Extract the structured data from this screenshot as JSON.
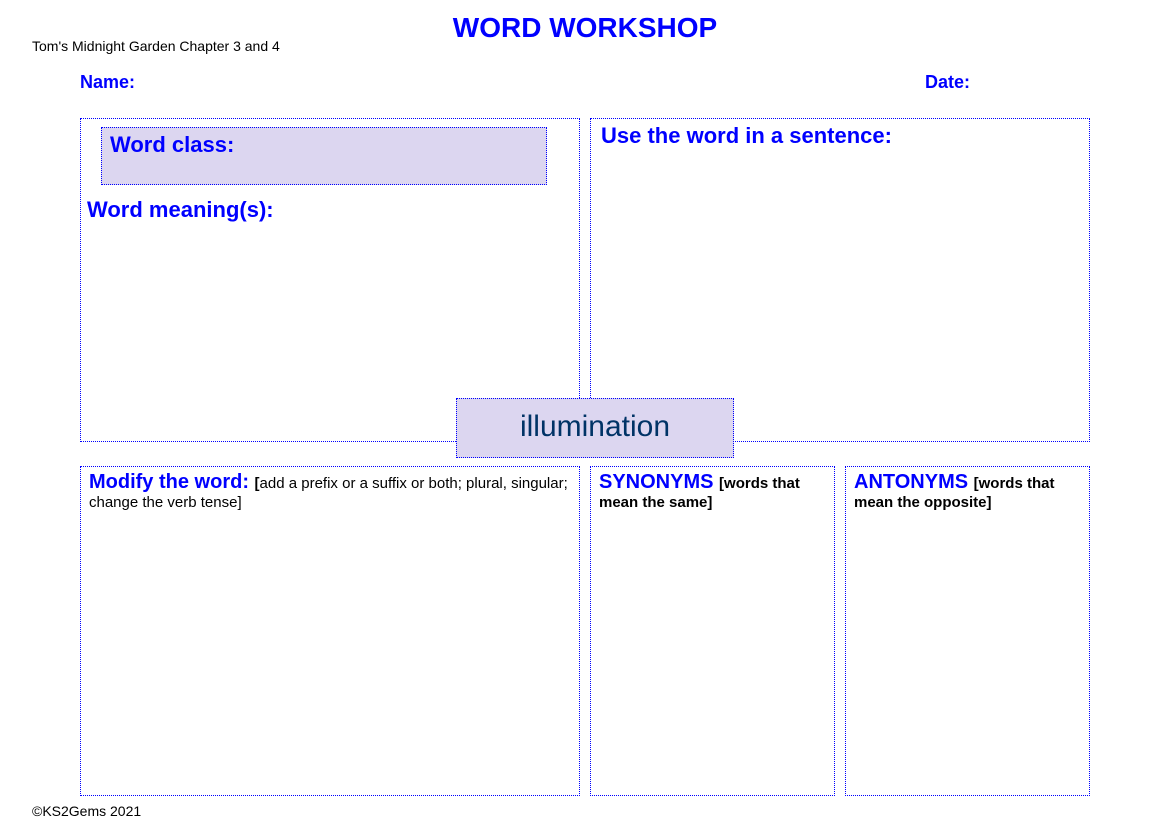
{
  "title": "WORD WORKSHOP",
  "subtitle": "Tom's Midnight Garden Chapter 3 and 4",
  "name_label": "Name:",
  "date_label": "Date:",
  "wordclass_label": "Word class:",
  "meanings_label": "Word meaning(s):",
  "sentence_label": "Use the word in a sentence:",
  "target_word": "illumination",
  "modify": {
    "heading": "Modify the word: ",
    "hint_bracket_open": "[",
    "hint_text": "add a prefix or a suffix or both; plural, singular; change the verb tense",
    "hint_bracket_close": "]"
  },
  "synonyms": {
    "heading": "SYNONYMS ",
    "hint": "[words that mean the same]"
  },
  "antonyms": {
    "heading": "ANTONYMS ",
    "hint": "[words that mean the opposite]"
  },
  "copyright": "©KS2Gems 2021"
}
